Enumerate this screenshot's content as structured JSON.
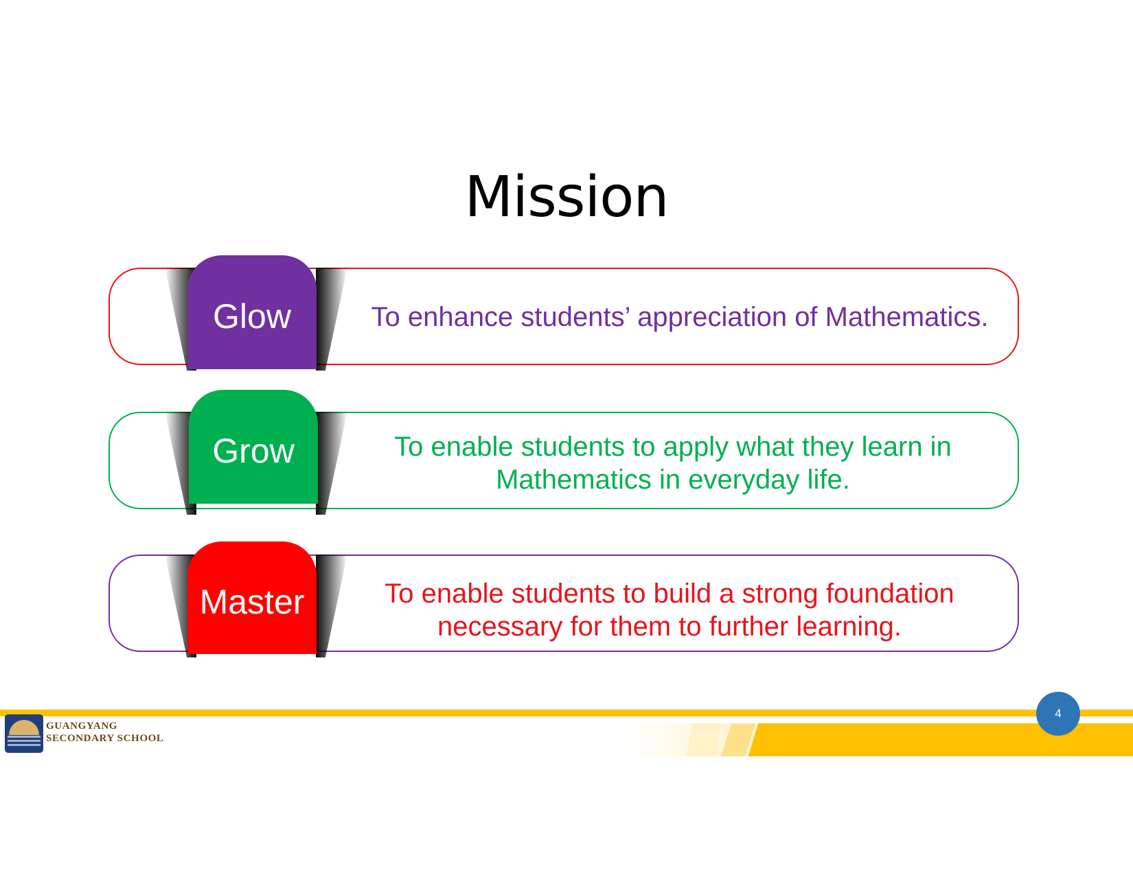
{
  "slide": {
    "title": "Mission",
    "page_number": "4"
  },
  "rows": [
    {
      "tab_label": "Glow",
      "tab_color": "#7030a0",
      "border_color": "#e8141b",
      "text_color": "#7030a0",
      "lines": [
        "To enhance students’ appreciation of Mathematics."
      ]
    },
    {
      "tab_label": "Grow",
      "tab_color": "#00b050",
      "border_color": "#00b050",
      "text_color": "#00b050",
      "lines": [
        "To enable students to apply what they learn in",
        "Mathematics in everyday life."
      ]
    },
    {
      "tab_label": "Master",
      "tab_color": "#ff0000",
      "border_color": "#7030a0",
      "text_color": "#e8141b",
      "lines": [
        "To enable students to build a strong foundation",
        "necessary for them to further learning."
      ]
    }
  ],
  "footer": {
    "school_name_line1": "GUANGYANG",
    "school_name_line2": "SECONDARY SCHOOL",
    "logo_icon": "school-crest-icon",
    "accent_color": "#ffc000",
    "badge_color": "#2e75b6"
  }
}
